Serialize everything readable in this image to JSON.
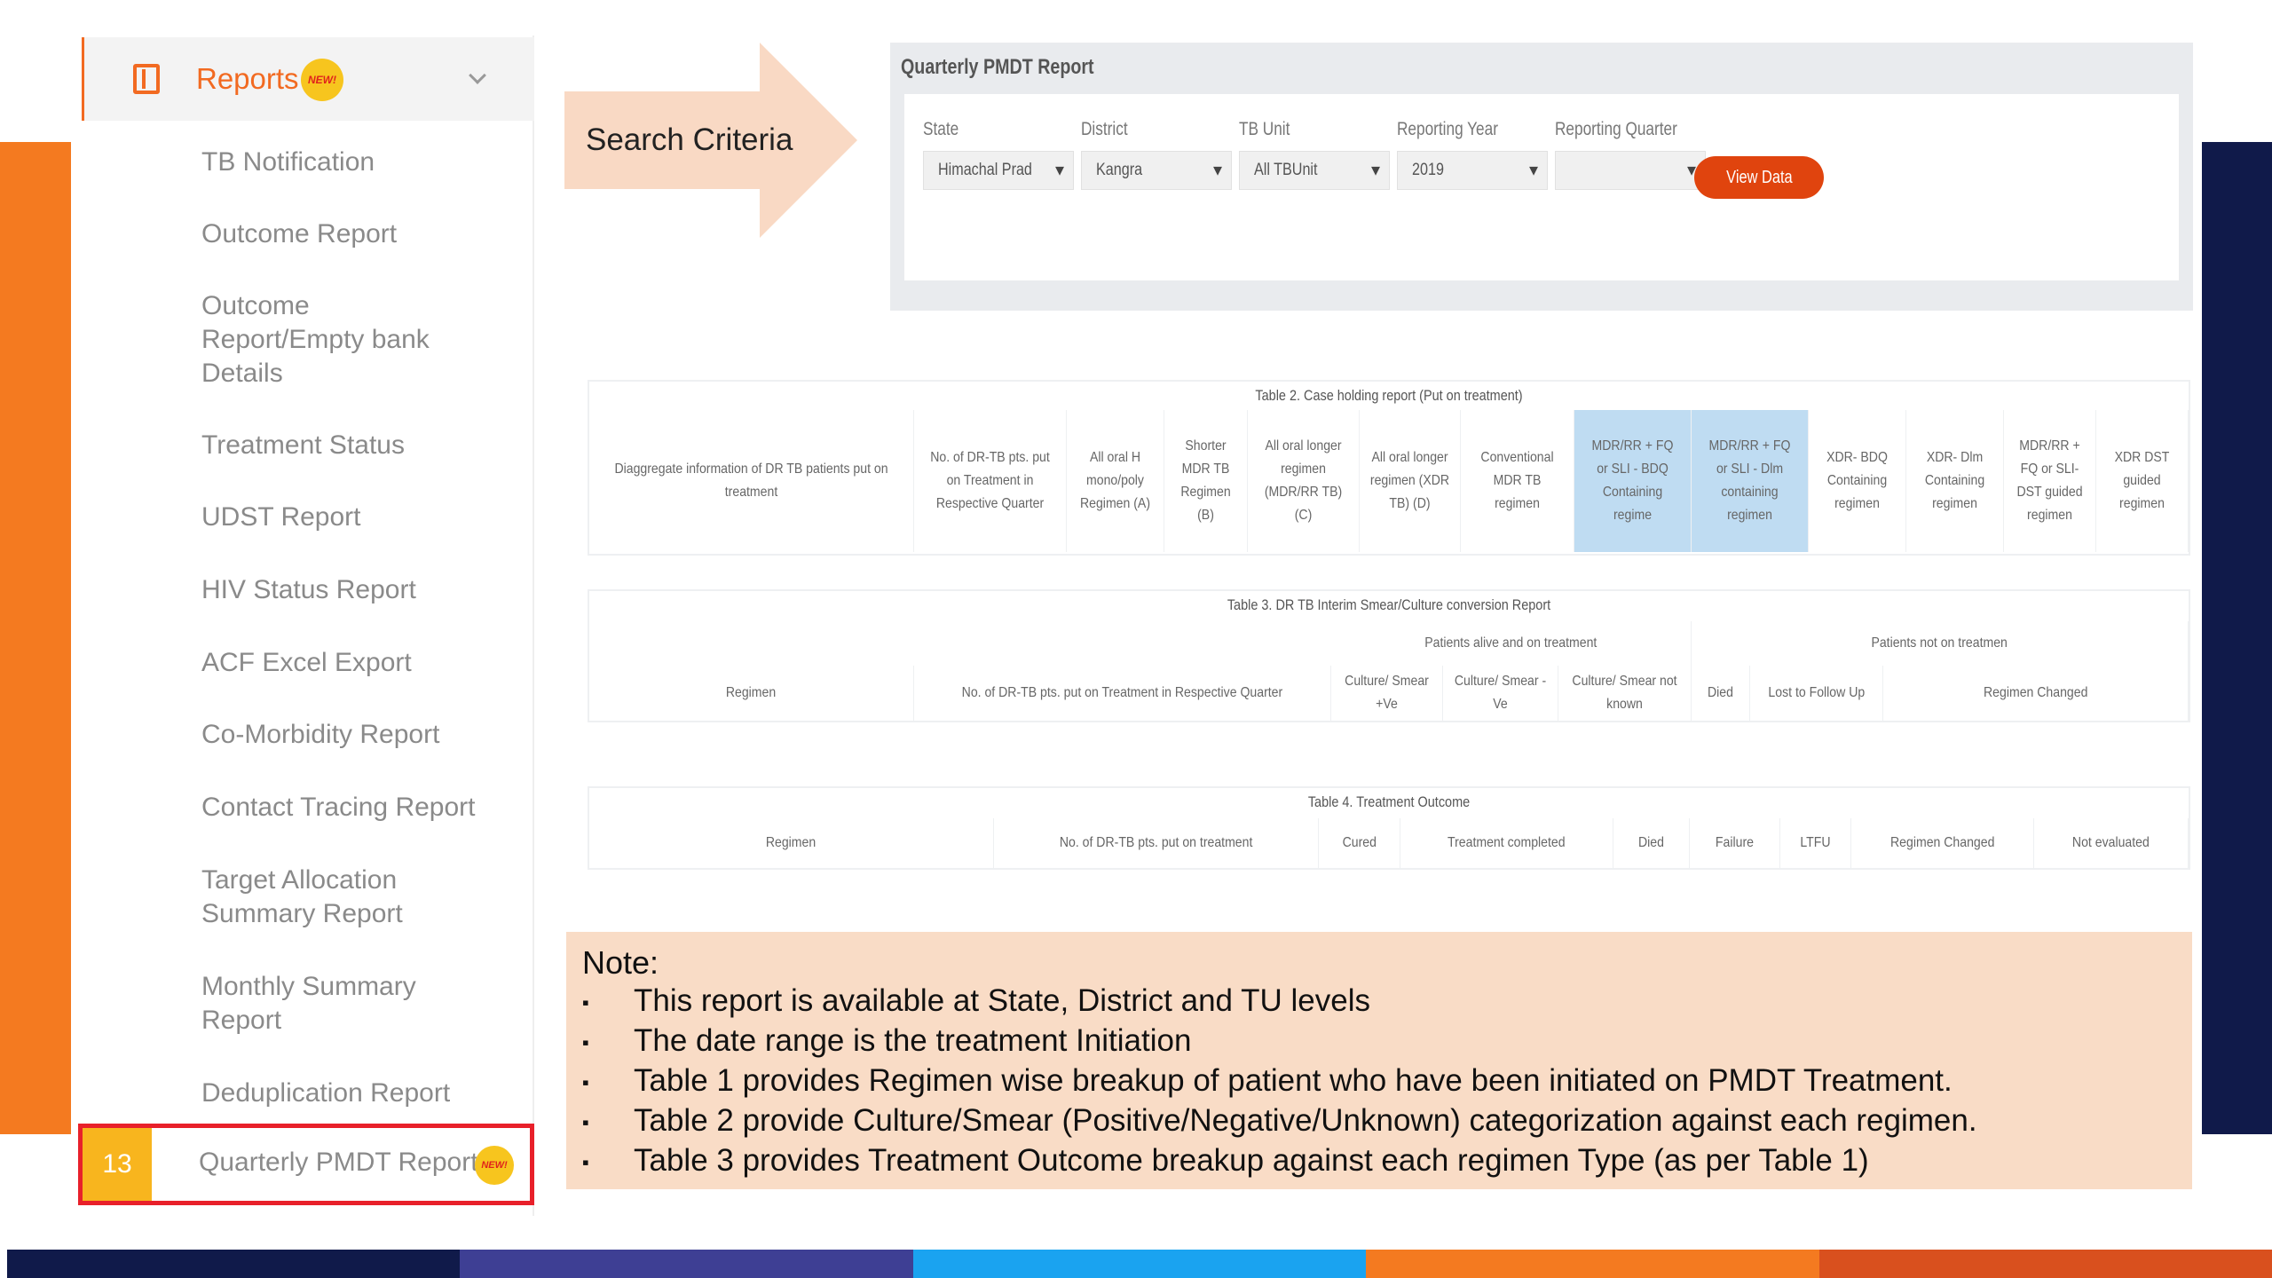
{
  "sidebar": {
    "header_label": "Reports",
    "new_badge": "NEW!",
    "items": [
      "TB Notification",
      "Outcome Report",
      "Outcome Report/Empty bank Details",
      "Treatment Status",
      "UDST Report",
      "HIV Status Report",
      "ACF Excel Export",
      "Co-Morbidity Report",
      "Contact Tracing Report",
      "Target Allocation Summary Report",
      "Monthly Summary Report",
      "Deduplication Report"
    ],
    "active": {
      "number": "13",
      "label": "Quarterly PMDT Report"
    }
  },
  "search_criteria": "Search Criteria",
  "panel": {
    "title": "Quarterly PMDT Report",
    "fields": [
      {
        "label": "State",
        "value": "Himachal Prad"
      },
      {
        "label": "District",
        "value": "Kangra"
      },
      {
        "label": "TB Unit",
        "value": "All TBUnit"
      },
      {
        "label": "Reporting Year",
        "value": "2019"
      },
      {
        "label": "Reporting Quarter",
        "value": ""
      }
    ],
    "view_button": "View Data"
  },
  "table2": {
    "caption": "Table 2. Case holding report (Put on treatment)",
    "headers": [
      "Diaggregate information of DR TB patients put on treatment",
      "No. of DR-TB pts. put on Treatment in Respective Quarter",
      "All oral H mono/poly Regimen (A)",
      "Shorter MDR TB Regimen (B)",
      "All oral longer regimen (MDR/RR TB) (C)",
      "All oral longer regimen (XDR TB) (D)",
      "Conventional MDR TB regimen",
      "MDR/RR + FQ or SLI - BDQ Containing regime",
      "MDR/RR + FQ or SLI - Dlm containing regimen",
      "XDR- BDQ Containing regimen",
      "XDR- Dlm Containing regimen",
      "MDR/RR + FQ or SLI- DST guided regimen",
      "XDR DST guided regimen"
    ]
  },
  "table3": {
    "caption": "Table 3. DR TB Interim Smear/Culture conversion Report",
    "group1": "Patients alive and on treatment",
    "group2": "Patients not on treatmen",
    "headers": [
      "Regimen",
      "No. of DR-TB pts. put on Treatment in Respective Quarter",
      "Culture/ Smear +Ve",
      "Culture/ Smear -Ve",
      "Culture/ Smear not known",
      "Died",
      "Lost to Follow Up",
      "Regimen Changed"
    ]
  },
  "table4": {
    "caption": "Table 4. Treatment Outcome",
    "headers": [
      "Regimen",
      "No. of DR-TB pts. put on treatment",
      "Cured",
      "Treatment completed",
      "Died",
      "Failure",
      "LTFU",
      "Regimen Changed",
      "Not evaluated"
    ]
  },
  "note": {
    "title": "Note:",
    "bullet": "▪",
    "lines": [
      "This report is available at State, District and TU levels",
      "The date range is the treatment Initiation",
      "Table 1 provides Regimen wise breakup of patient who have been initiated on PMDT Treatment.",
      "Table 2 provide Culture/Smear (Positive/Negative/Unknown) categorization against each regimen.",
      "Table 3 provides Treatment Outcome breakup against each regimen Type (as per Table 1)"
    ]
  },
  "colors": {
    "accent_orange": "#f26a21",
    "active_border": "#e8202a",
    "view_button": "#e0440e",
    "highlight_header": "#bfdcf2",
    "note_background": "#f9dcc6",
    "bottom_stripe": [
      "#101a4a",
      "#3e3f94",
      "#1aa3f0",
      "#f47a20",
      "#d9501e"
    ]
  }
}
